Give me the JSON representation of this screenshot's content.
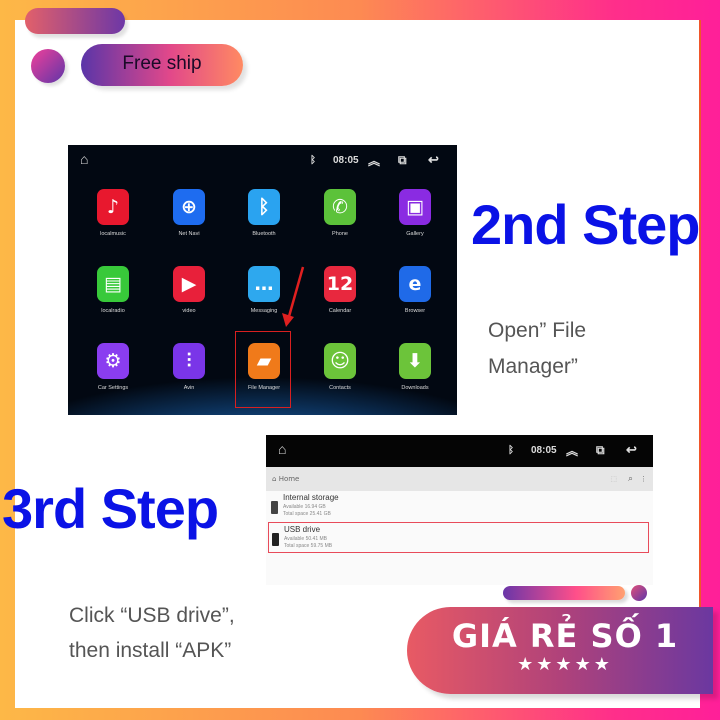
{
  "banner": {
    "free_ship": "Free ship",
    "price_title": "GIÁ RẺ SỐ 1",
    "stars": "★★★★★",
    "rating_stars": 5
  },
  "screen1": {
    "status_time": "08:05",
    "apps": [
      {
        "label": "localmusic",
        "icon": "music-note-icon",
        "color": "#e8182e",
        "glyph": "♪"
      },
      {
        "label": "Net Navi",
        "icon": "compass-icon",
        "color": "#1e6cf0",
        "glyph": "⊕"
      },
      {
        "label": "Bluetooth",
        "icon": "bluetooth-icon",
        "color": "#2aa3f0",
        "glyph": "ᛒ"
      },
      {
        "label": "Phone",
        "icon": "phone-icon",
        "color": "#5cc23a",
        "glyph": "✆"
      },
      {
        "label": "Gallery",
        "icon": "gallery-icon",
        "color": "#8a2be2",
        "glyph": "▣"
      },
      {
        "label": "localradio",
        "icon": "radio-icon",
        "color": "#38c93a",
        "glyph": "▤"
      },
      {
        "label": "video",
        "icon": "play-icon",
        "color": "#e8203a",
        "glyph": "▶"
      },
      {
        "label": "Messaging",
        "icon": "message-icon",
        "color": "#2ea8ee",
        "glyph": "…"
      },
      {
        "label": "Calendar",
        "icon": "calendar-icon",
        "color": "#e8283e",
        "glyph": "12"
      },
      {
        "label": "Browser",
        "icon": "browser-icon",
        "color": "#1f6ae8",
        "glyph": "e"
      },
      {
        "label": "Car Settings",
        "icon": "gear-icon",
        "color": "#8a3df0",
        "glyph": "⚙"
      },
      {
        "label": "Avin",
        "icon": "equalizer-icon",
        "color": "#7a35e8",
        "glyph": "⫶"
      },
      {
        "label": "File Manager",
        "icon": "folder-icon",
        "color": "#f07a1a",
        "glyph": "▰"
      },
      {
        "label": "Contacts",
        "icon": "contact-icon",
        "color": "#6cc43a",
        "glyph": "☺"
      },
      {
        "label": "Downloads",
        "icon": "download-icon",
        "color": "#6cc43a",
        "glyph": "⬇"
      }
    ]
  },
  "step2": {
    "title": "2nd Step",
    "line1": "Open” File",
    "line2": "Manager”"
  },
  "step3": {
    "title": "3rd Step",
    "line1": "Click “USB drive”,",
    "line2": "then install “APK”"
  },
  "screen2": {
    "status_time": "08:05",
    "breadcrumb": "Home",
    "items": [
      {
        "name": "Internal storage",
        "available": "Available 16.94 GB",
        "total": "Total space 25.41 GB"
      },
      {
        "name": "USB drive",
        "available": "Available 50.41 MB",
        "total": "Total space 59.75 MB"
      }
    ]
  }
}
